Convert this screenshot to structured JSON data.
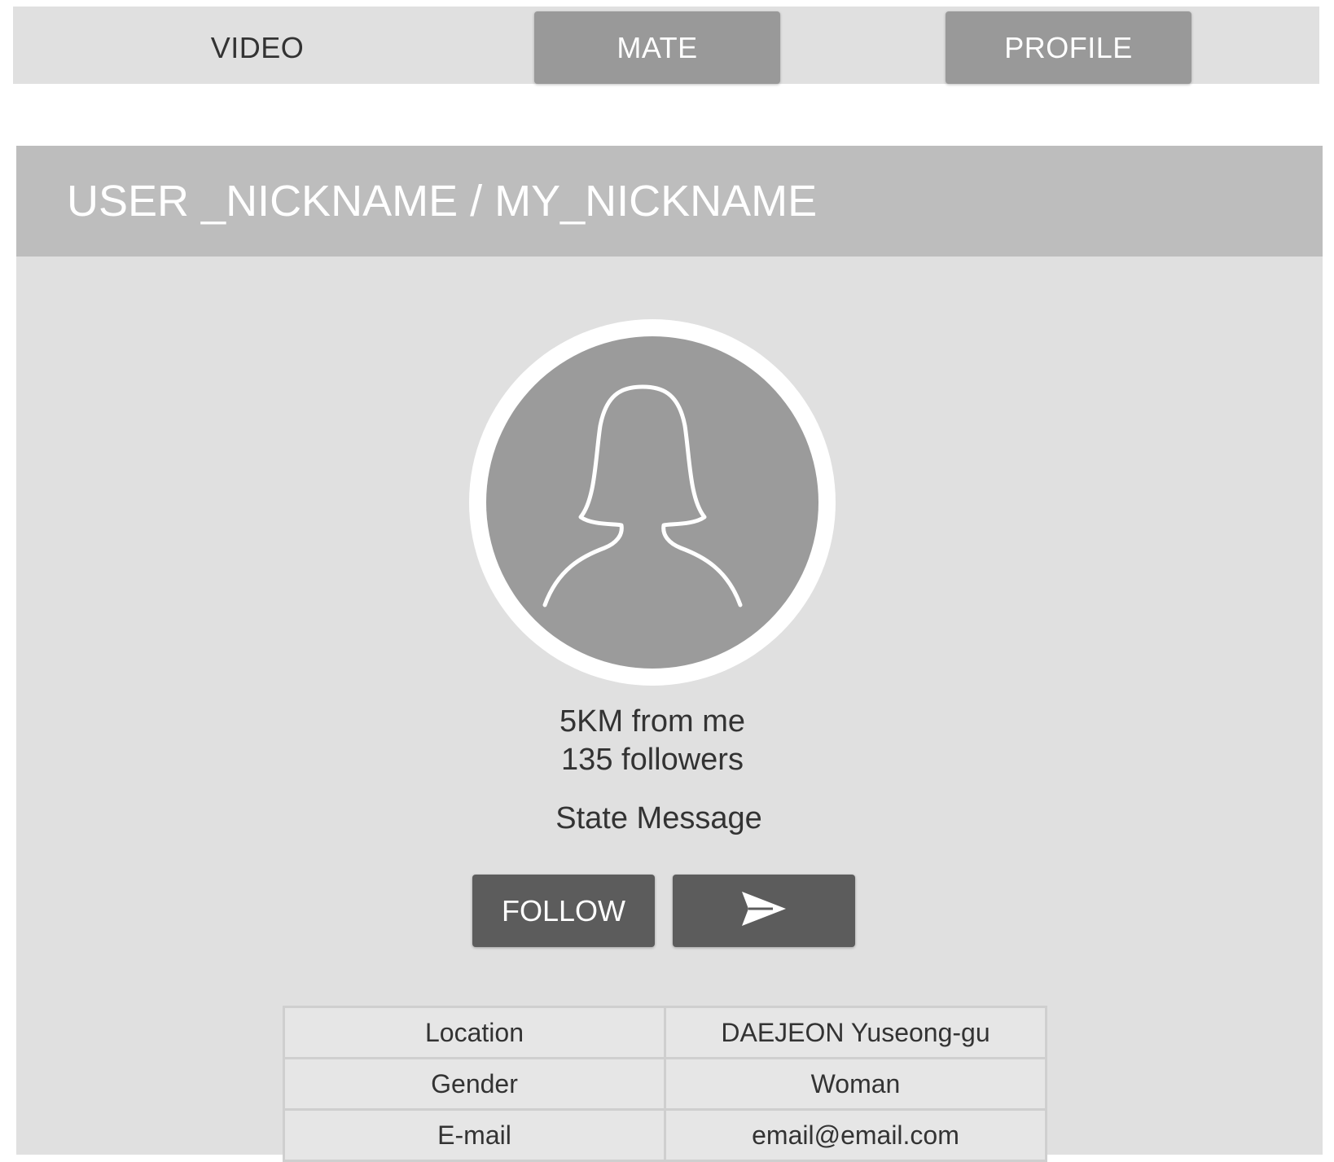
{
  "nav": {
    "tabs": [
      {
        "label": "VIDEO"
      },
      {
        "label": "MATE"
      },
      {
        "label": "PROFILE"
      }
    ]
  },
  "profile": {
    "title": "USER _NICKNAME / MY_NICKNAME",
    "distance": "5KM from me",
    "followers": "135 followers",
    "state_message": "State Message",
    "follow_label": "FOLLOW",
    "send_icon": "send-arrow-icon",
    "avatar_icon": "female-user-silhouette-icon"
  },
  "details": {
    "rows": [
      {
        "label": "Location",
        "value": "DAEJEON Yuseong-gu"
      },
      {
        "label": "Gender",
        "value": "Woman"
      },
      {
        "label": "E-mail",
        "value": "email@email.com"
      }
    ]
  },
  "colors": {
    "nav_bg": "#e0e0e0",
    "tab_active_bg": "#999999",
    "header_bg": "#bdbdbd",
    "panel_bg": "#e0e0e0",
    "button_bg": "#5c5c5c",
    "avatar_bg": "#9b9b9b"
  }
}
